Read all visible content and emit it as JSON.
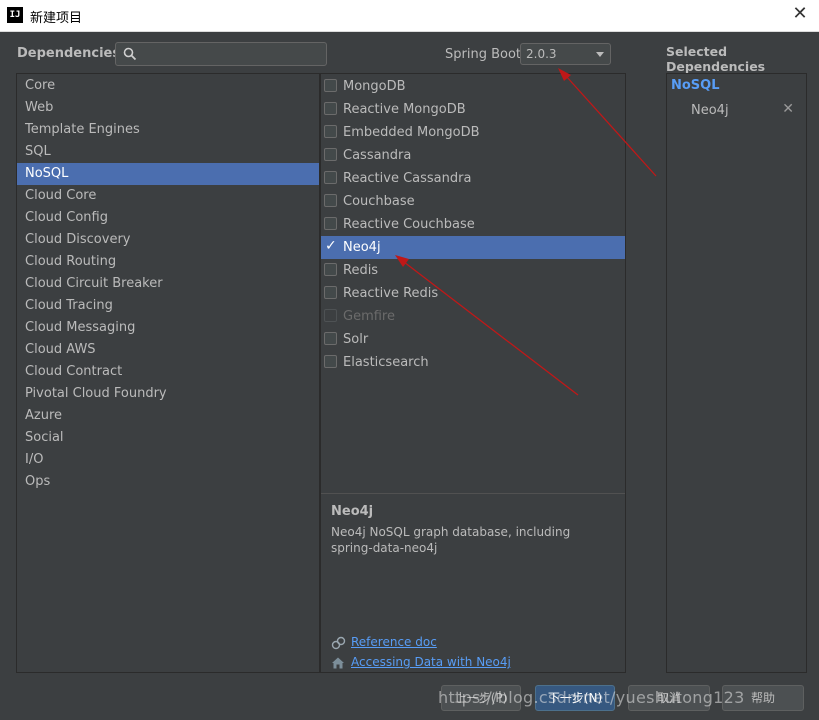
{
  "window": {
    "title": "新建项目",
    "app_icon_text": "IJ",
    "close_glyph": "✕"
  },
  "header": {
    "dependencies_label": "Dependencies",
    "search_value": "",
    "search_placeholder": "",
    "spring_boot_label": "Spring Boot",
    "spring_boot_version": "2.0.3",
    "selected_label": "Selected Dependencies"
  },
  "categories": [
    "Core",
    "Web",
    "Template Engines",
    "SQL",
    "NoSQL",
    "Cloud Core",
    "Cloud Config",
    "Cloud Discovery",
    "Cloud Routing",
    "Cloud Circuit Breaker",
    "Cloud Tracing",
    "Cloud Messaging",
    "Cloud AWS",
    "Cloud Contract",
    "Pivotal Cloud Foundry",
    "Azure",
    "Social",
    "I/O",
    "Ops"
  ],
  "selected_category": "NoSQL",
  "dependencies": [
    {
      "label": "MongoDB",
      "checked": false,
      "enabled": true
    },
    {
      "label": "Reactive MongoDB",
      "checked": false,
      "enabled": true
    },
    {
      "label": "Embedded MongoDB",
      "checked": false,
      "enabled": true
    },
    {
      "label": "Cassandra",
      "checked": false,
      "enabled": true
    },
    {
      "label": "Reactive Cassandra",
      "checked": false,
      "enabled": true
    },
    {
      "label": "Couchbase",
      "checked": false,
      "enabled": true
    },
    {
      "label": "Reactive Couchbase",
      "checked": false,
      "enabled": true
    },
    {
      "label": "Neo4j",
      "checked": true,
      "enabled": true
    },
    {
      "label": "Redis",
      "checked": false,
      "enabled": true
    },
    {
      "label": "Reactive Redis",
      "checked": false,
      "enabled": true
    },
    {
      "label": "Gemfire",
      "checked": false,
      "enabled": false
    },
    {
      "label": "Solr",
      "checked": false,
      "enabled": true
    },
    {
      "label": "Elasticsearch",
      "checked": false,
      "enabled": true
    }
  ],
  "selected_dependency": "Neo4j",
  "detail": {
    "title": "Neo4j",
    "description": "Neo4j NoSQL graph database, including spring-data-neo4j",
    "links": [
      {
        "label": "Reference doc",
        "icon": "reference-doc-icon"
      },
      {
        "label": "Accessing Data with Neo4j",
        "icon": "guide-home-icon"
      }
    ]
  },
  "selected_panel": {
    "group": "NoSQL",
    "items": [
      {
        "label": "Neo4j",
        "remove_glyph": "✕"
      }
    ]
  },
  "buttons": {
    "previous": "上一步(P)",
    "next": "下一步(N)",
    "cancel": "取消",
    "help": "帮助"
  },
  "watermark": "https://blog.csdn.net/yueshutong123",
  "colors": {
    "background": "#3c3f41",
    "selection": "#4b6eaf",
    "link": "#589df6",
    "annotation_arrow": "#c01818"
  }
}
